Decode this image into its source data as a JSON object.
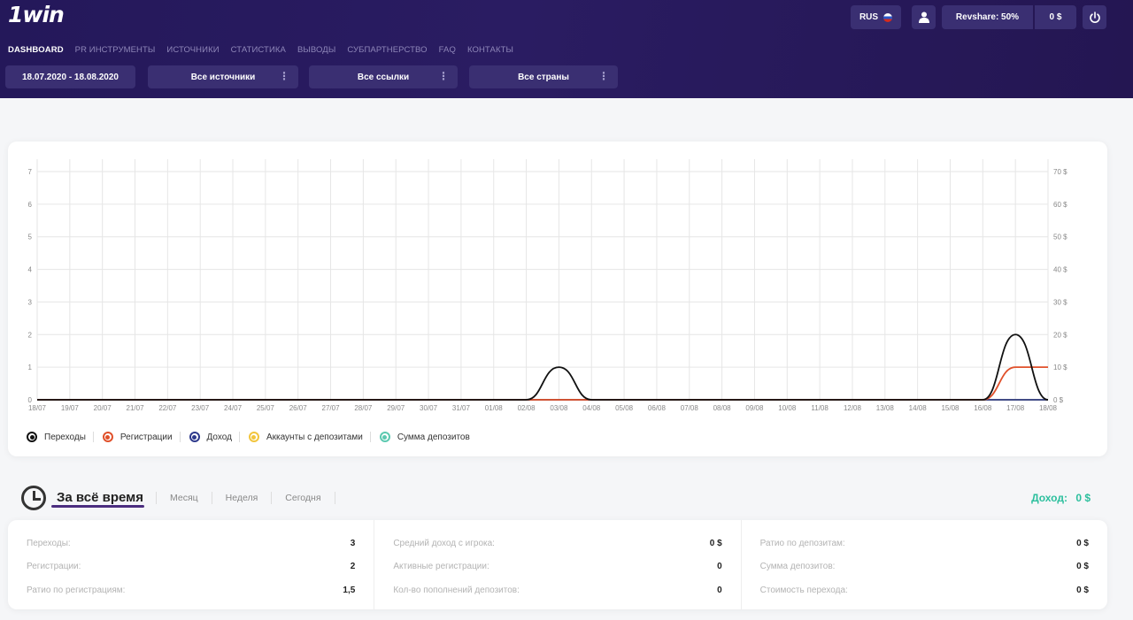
{
  "header": {
    "logo": "1win",
    "nav": [
      "DASHBOARD",
      "PR ИНСТРУМЕНТЫ",
      "ИСТОЧНИКИ",
      "СТАТИСТИКА",
      "ВЫВОДЫ",
      "СУБПАРТНЕРСТВО",
      "FAQ",
      "КОНТАКТЫ"
    ],
    "lang": "RUS",
    "revshare": "Revshare: 50%",
    "balance": "0 $"
  },
  "filters": {
    "date_range": "18.07.2020 - 18.08.2020",
    "sources": "Все источники",
    "links": "Все ссылки",
    "countries": "Все страны",
    "menu_glyph": "⋮"
  },
  "chart_data": {
    "type": "line",
    "categories": [
      "18/07",
      "19/07",
      "20/07",
      "21/07",
      "22/07",
      "23/07",
      "24/07",
      "25/07",
      "26/07",
      "27/07",
      "28/07",
      "29/07",
      "30/07",
      "31/07",
      "01/08",
      "02/08",
      "03/08",
      "04/08",
      "05/08",
      "06/08",
      "07/08",
      "08/08",
      "09/08",
      "10/08",
      "11/08",
      "12/08",
      "13/08",
      "14/08",
      "15/08",
      "16/08",
      "17/08",
      "18/08"
    ],
    "ylim_left": [
      0,
      7
    ],
    "yticks_left": [
      "0",
      "1",
      "2",
      "3",
      "4",
      "5",
      "6",
      "7"
    ],
    "ylim_right": [
      0,
      70
    ],
    "yticks_right": [
      "0 $",
      "10 $",
      "20 $",
      "30 $",
      "40 $",
      "50 $",
      "60 $",
      "70 $"
    ],
    "grid": true,
    "legend_position": "bottom-left",
    "series": [
      {
        "name": "Переходы",
        "color": "#111111",
        "axis": "left",
        "values": [
          0,
          0,
          0,
          0,
          0,
          0,
          0,
          0,
          0,
          0,
          0,
          0,
          0,
          0,
          0,
          0,
          1,
          0,
          0,
          0,
          0,
          0,
          0,
          0,
          0,
          0,
          0,
          0,
          0,
          0,
          2,
          0
        ]
      },
      {
        "name": "Регистрации",
        "color": "#e0502a",
        "axis": "left",
        "values": [
          0,
          0,
          0,
          0,
          0,
          0,
          0,
          0,
          0,
          0,
          0,
          0,
          0,
          0,
          0,
          0,
          0,
          0,
          0,
          0,
          0,
          0,
          0,
          0,
          0,
          0,
          0,
          0,
          0,
          0,
          1,
          1
        ]
      },
      {
        "name": "Доход",
        "color": "#2e3a8c",
        "axis": "right",
        "values": [
          0,
          0,
          0,
          0,
          0,
          0,
          0,
          0,
          0,
          0,
          0,
          0,
          0,
          0,
          0,
          0,
          0,
          0,
          0,
          0,
          0,
          0,
          0,
          0,
          0,
          0,
          0,
          0,
          0,
          0,
          0,
          0
        ]
      },
      {
        "name": "Аккаунты с депозитами",
        "color": "#f2c53d",
        "axis": "left",
        "values": [
          0,
          0,
          0,
          0,
          0,
          0,
          0,
          0,
          0,
          0,
          0,
          0,
          0,
          0,
          0,
          0,
          0,
          0,
          0,
          0,
          0,
          0,
          0,
          0,
          0,
          0,
          0,
          0,
          0,
          0,
          0,
          0
        ]
      },
      {
        "name": "Сумма депозитов",
        "color": "#5cc9b0",
        "axis": "right",
        "values": [
          0,
          0,
          0,
          0,
          0,
          0,
          0,
          0,
          0,
          0,
          0,
          0,
          0,
          0,
          0,
          0,
          0,
          0,
          0,
          0,
          0,
          0,
          0,
          0,
          0,
          0,
          0,
          0,
          0,
          0,
          0,
          0
        ]
      }
    ]
  },
  "period": {
    "tabs": [
      "За всё время",
      "Месяц",
      "Неделя",
      "Сегодня"
    ],
    "income_label": "Доход:",
    "income_value": "0 $"
  },
  "stats": [
    [
      {
        "label": "Переходы:",
        "value": "3"
      },
      {
        "label": "Регистрации:",
        "value": "2"
      },
      {
        "label": "Ратио по регистрациям:",
        "value": "1,5"
      }
    ],
    [
      {
        "label": "Средний доход с игрока:",
        "value": "0 $"
      },
      {
        "label": "Активные регистрации:",
        "value": "0"
      },
      {
        "label": "Кол-во пополнений депозитов:",
        "value": "0"
      }
    ],
    [
      {
        "label": "Ратио по депозитам:",
        "value": "0 $"
      },
      {
        "label": "Сумма депозитов:",
        "value": "0 $"
      },
      {
        "label": "Стоимость перехода:",
        "value": "0 $"
      }
    ]
  ]
}
